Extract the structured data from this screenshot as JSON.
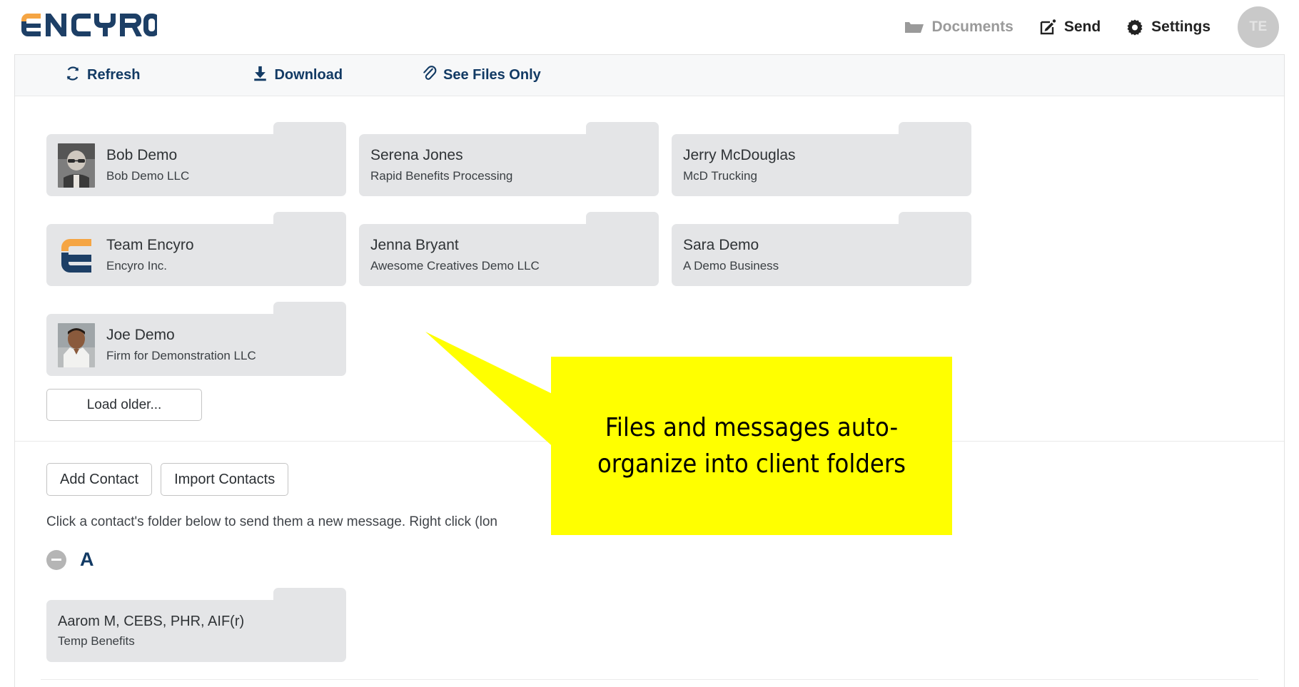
{
  "brand": {
    "logo_text": "ENCYRO",
    "logo_accent_color": "#f5a544",
    "logo_color": "#1d3f66"
  },
  "header": {
    "nav": [
      {
        "label": "Documents",
        "icon": "folder-icon",
        "active": false
      },
      {
        "label": "Send",
        "icon": "compose-icon",
        "active": true
      },
      {
        "label": "Settings",
        "icon": "gear-icon",
        "active": true
      }
    ],
    "avatar_initials": "TE"
  },
  "toolbar": {
    "refresh_label": "Refresh",
    "download_label": "Download",
    "files_only_label": "See Files Only"
  },
  "recent_folders": [
    {
      "name": "Bob Demo",
      "org": "Bob Demo LLC",
      "thumb": "photo-bob"
    },
    {
      "name": "Serena Jones",
      "org": "Rapid Benefits Processing",
      "thumb": "none"
    },
    {
      "name": "Jerry McDouglas",
      "org": "McD Trucking",
      "thumb": "none"
    },
    {
      "name": "Team Encyro",
      "org": "Encyro Inc.",
      "thumb": "encyro-logo"
    },
    {
      "name": "Jenna Bryant",
      "org": "Awesome Creatives Demo LLC",
      "thumb": "none"
    },
    {
      "name": "Sara Demo",
      "org": "A Demo Business",
      "thumb": "none"
    },
    {
      "name": "Joe Demo",
      "org": "Firm for Demonstration LLC",
      "thumb": "photo-joe"
    }
  ],
  "load_older_label": "Load older...",
  "actions": {
    "add_contact_label": "Add Contact",
    "import_contacts_label": "Import Contacts"
  },
  "hint_text": "Click a contact's folder below to send them a new message. Right click (lon",
  "alpha_section": {
    "letter": "A",
    "collapse_icon": "minus-circle-icon",
    "folders": [
      {
        "name": "Aarom M, CEBS, PHR, AIF(r)",
        "org": "Temp Benefits",
        "thumb": "none"
      }
    ]
  },
  "annotation": {
    "text": "Files and messages auto-organize into client folders",
    "background_color": "#ffff00",
    "text_color": "#000000"
  }
}
